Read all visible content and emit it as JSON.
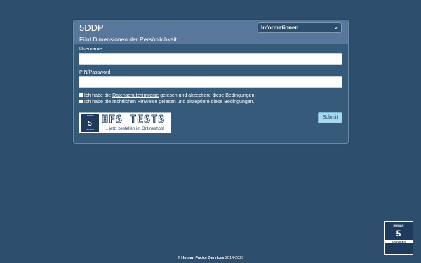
{
  "app": {
    "brand": "5DDP",
    "subtitle": "Fünf Dimensionen der Persönlichkeit",
    "nav_select": "Informationen"
  },
  "form": {
    "username_label": "Username",
    "username_value": "",
    "password_label": "PIN/Password",
    "password_value": "",
    "privacy": {
      "prefix": "Ich habe die ",
      "link": "Datenschutzhinweise",
      "suffix": " gelesen und akzeptiere diese Bedingungen."
    },
    "legal": {
      "prefix": "Ich habe die ",
      "link": "rechtlichen Hinweise",
      "suffix": " gelesen und akzeptiere diese Bedingungen."
    },
    "submit_label": "Submit"
  },
  "promo": {
    "title": "HFS TESTS",
    "order_text": "... jetzt bestellen im Onlineshop!",
    "mark_top": "HUMAN",
    "mark_mid": "5",
    "mark_bottom": "FACTOR"
  },
  "footer": {
    "copyright": "©",
    "company": "Human Factor Services",
    "years": "2014-2025"
  },
  "corner_logo": {
    "top": "HUMAN",
    "mid": "5",
    "bottom": "SERVICES"
  },
  "colors": {
    "background": "#2d4e6d",
    "panel_header": "#58779a",
    "submit": "#a8d8f0"
  }
}
